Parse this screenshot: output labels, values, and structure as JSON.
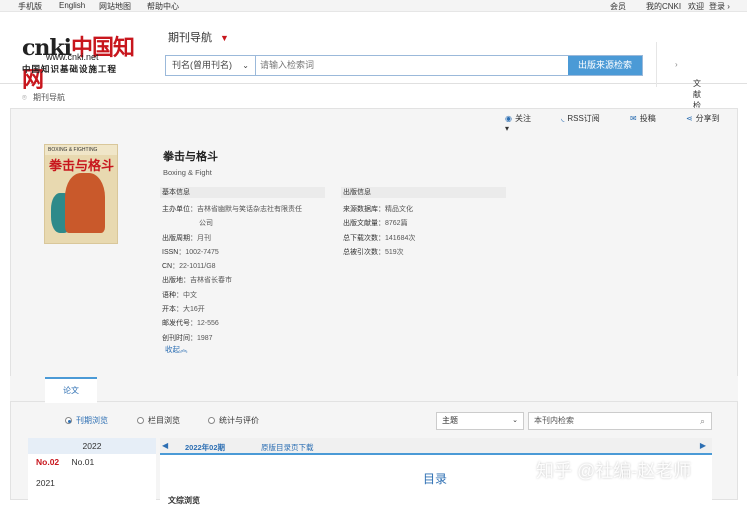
{
  "topbar": {
    "mobile": "手机版",
    "english": "English",
    "sitemap": "网站地图",
    "help": "帮助中心",
    "member": "会员",
    "mycnki": "我的CNKI",
    "welcome": "欢迎",
    "login": "登录"
  },
  "logo": {
    "url": "www.cnki.net",
    "slogan": "中国知识基础设施工程"
  },
  "search": {
    "nav_select": "期刊导航",
    "field_select": "刊名(曾用刊名)",
    "placeholder": "请输入检索词",
    "button": "出版来源检索",
    "advanced": "文献检索"
  },
  "breadcrumb": "期刊导航",
  "actions": {
    "follow": "关注",
    "rss": "RSS订阅",
    "submit": "投稿",
    "share": "分享到"
  },
  "journal": {
    "cover_title": "拳击与格斗",
    "cover_sub": "BOXING & FIGHTING",
    "title": "拳击与格斗",
    "english": "Boxing & Fight",
    "basic_header": "基本信息",
    "pub_header": "出版信息",
    "basic": [
      {
        "label": "主办单位：",
        "value": "吉林省幽默与笑话杂志社有限责任"
      },
      {
        "label": "",
        "value": "公司"
      },
      {
        "label": "出版周期：",
        "value": "月刊"
      },
      {
        "label": "ISSN：",
        "value": "1002-7475"
      },
      {
        "label": "CN：",
        "value": "22-1011/G8"
      },
      {
        "label": "出版地：",
        "value": "吉林省长春市"
      },
      {
        "label": "语种：",
        "value": "中文"
      },
      {
        "label": "开本：",
        "value": "大16开"
      },
      {
        "label": "邮发代号：",
        "value": "12-556"
      },
      {
        "label": "创刊时间：",
        "value": "1987"
      }
    ],
    "pub": [
      {
        "label": "来源数据库：",
        "value": "精品文化"
      },
      {
        "label": "出版文献量：",
        "value": "8762篇"
      },
      {
        "label": "总下载次数：",
        "value": "141684次"
      },
      {
        "label": "总被引次数：",
        "value": "519次"
      }
    ],
    "collapse": "收起"
  },
  "tabs": {
    "papers": "论文"
  },
  "browse": {
    "by_issue": "刊期浏览",
    "by_column": "栏目浏览",
    "stats": "统计与评价",
    "select_value": "主题",
    "search_placeholder": "本刊内检索"
  },
  "years": {
    "year1": "2022",
    "issue_cur": "No.02",
    "issue_other": "No.01",
    "year2": "2021"
  },
  "contents": {
    "current": "2022年02期",
    "link": "原版目录页下载",
    "title": "目录",
    "first_section": "文综浏览"
  },
  "watermark": "知乎 @社编-赵老师"
}
